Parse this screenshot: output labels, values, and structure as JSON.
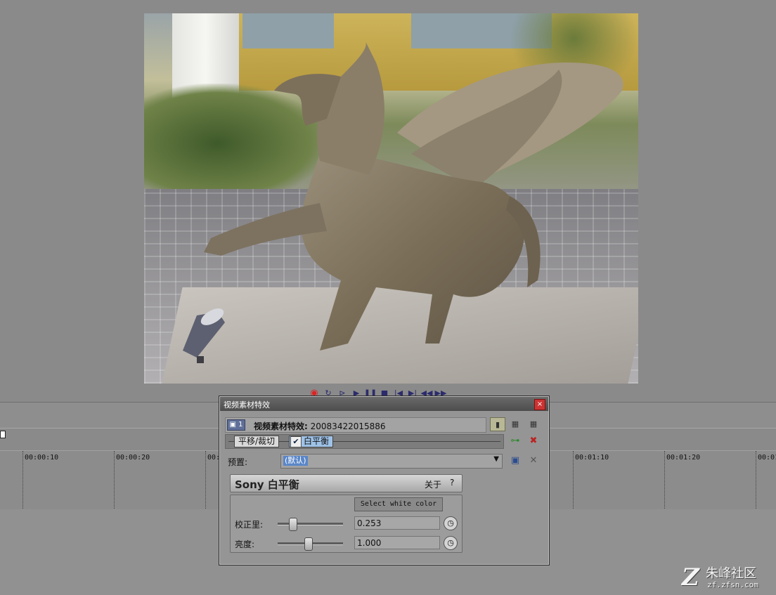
{
  "transport": {
    "icons": [
      "record-icon",
      "loop-icon",
      "play-from-start-icon",
      "play-icon",
      "pause-icon",
      "stop-icon",
      "prev-frame-icon",
      "next-frame-icon",
      "prev-marker-icon",
      "next-marker-icon"
    ],
    "glyphs": [
      "◉",
      "↻",
      "⊳",
      "▶",
      "❚❚",
      "■",
      "|◀",
      "▶|",
      "◀◀",
      "▶▶"
    ]
  },
  "timeline": {
    "ticks": [
      "00:00:10",
      "00:00:20",
      "00:0",
      "",
      "",
      "00:01:10",
      "00:01:20",
      "00:01"
    ]
  },
  "dialog": {
    "title": "视频素材特效",
    "close_glyph": "×",
    "chain_badge": "▣ 1",
    "chain_label_bold": "视频素材特效:",
    "chain_label_id": "20083422015886",
    "fx_chain": [
      {
        "label": "平移/裁切",
        "checked": false
      },
      {
        "label": "白平衡",
        "checked": true
      }
    ],
    "preset_label": "预置:",
    "preset_value": "(默认)",
    "plugin_name": "Sony 白平衡",
    "about_label": "关于",
    "help_label": "?",
    "select_white_label": "Select white color",
    "params": [
      {
        "label": "校正里:",
        "value": "0.253",
        "slider_fraction": 0.24
      },
      {
        "label": "亮度:",
        "value": "1.000",
        "slider_fraction": 0.47
      }
    ]
  },
  "watermark": {
    "logo": "Z",
    "main": "朱峰社区",
    "sub": "zf.zfsn.com"
  },
  "colors": {
    "background": "#8a8a8a",
    "title_bar": "#4d4d4d",
    "accent_selected": "#5a86c8",
    "close_red": "#cc3333"
  }
}
